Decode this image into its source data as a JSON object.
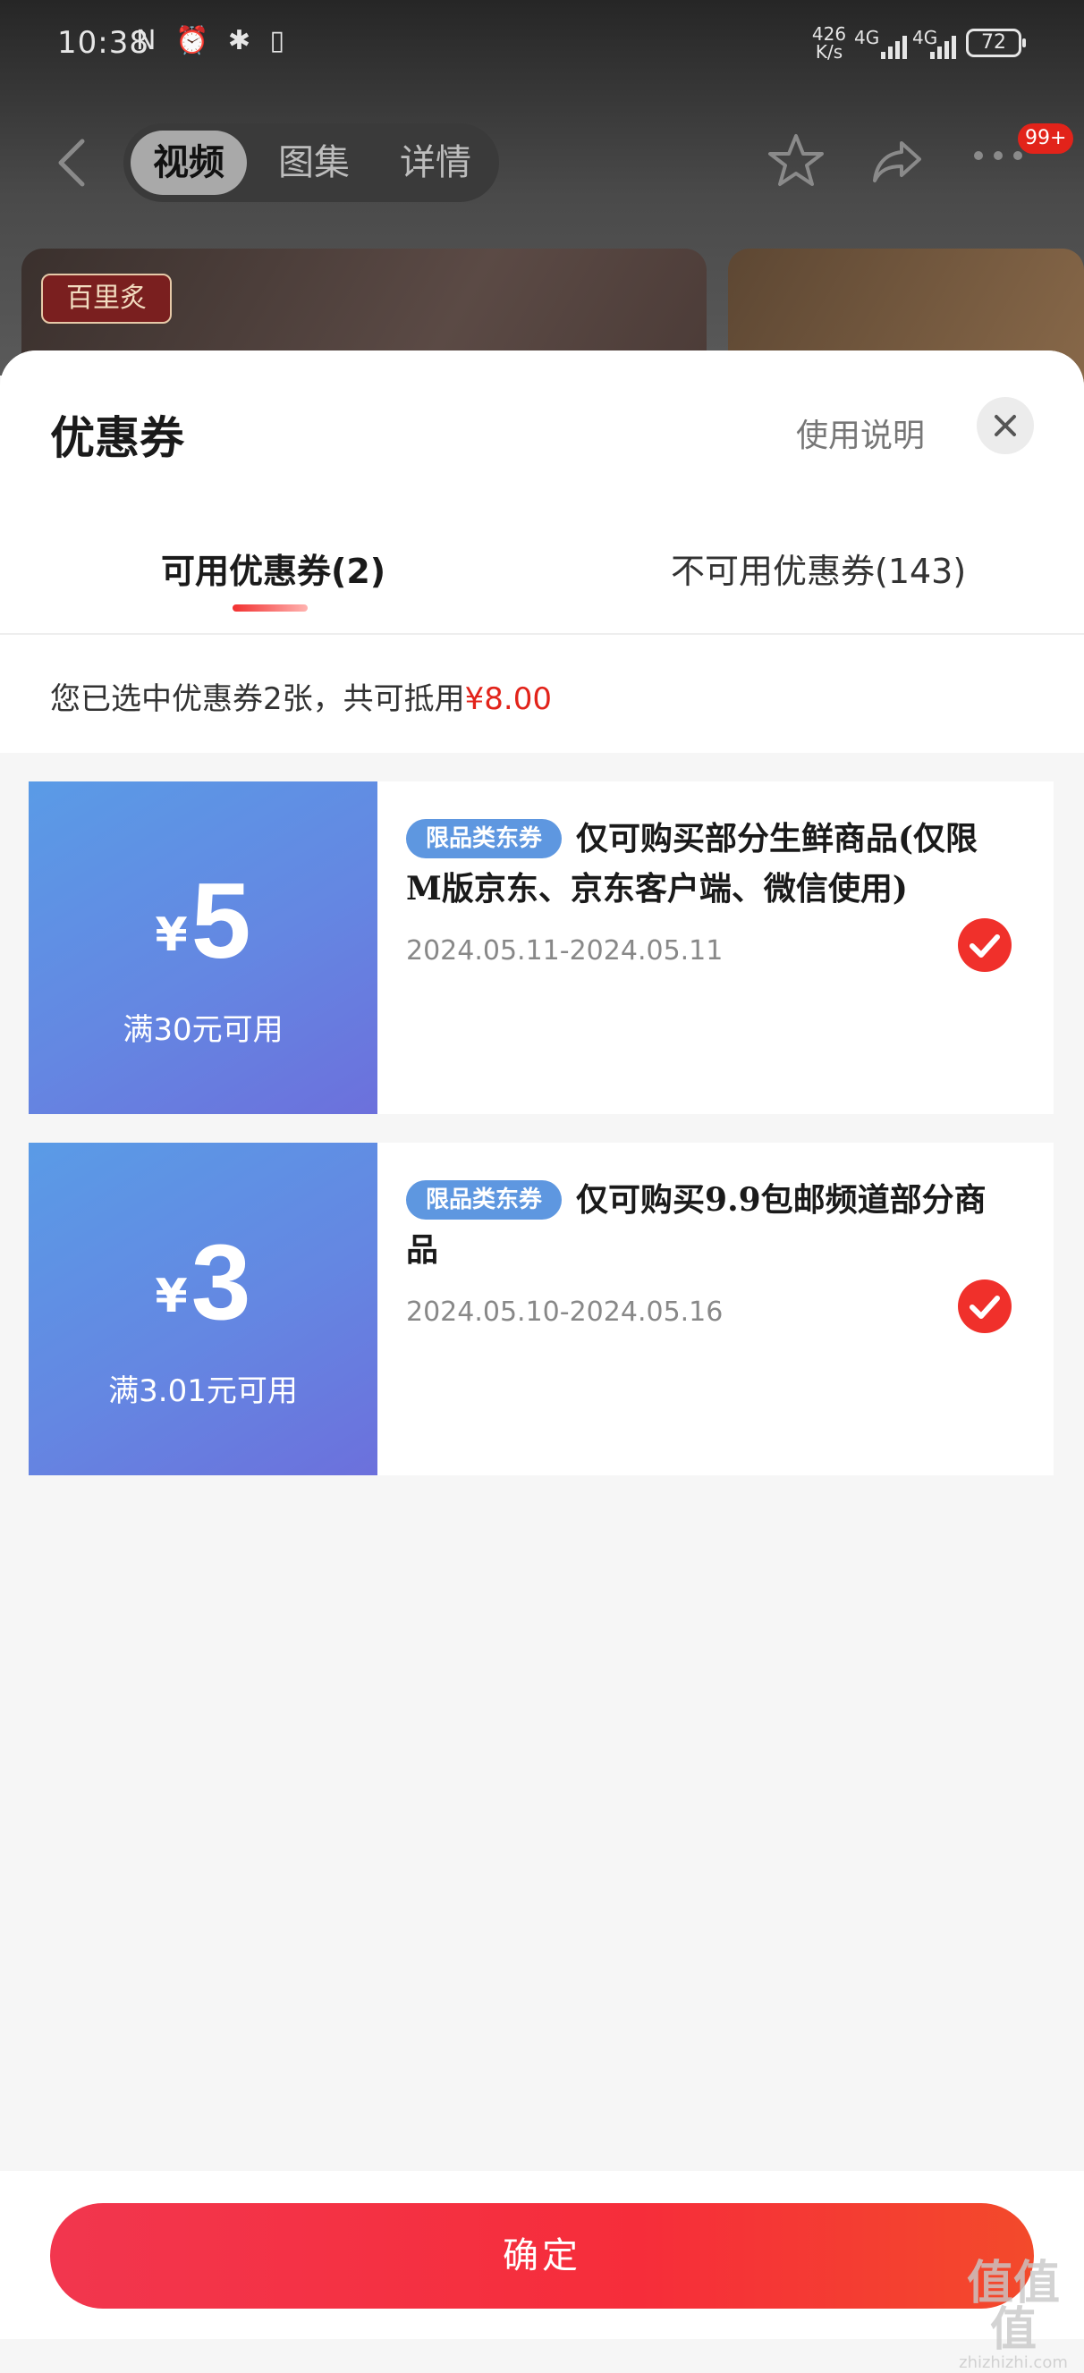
{
  "status_bar": {
    "time": "10:38",
    "indicator_icons": "N ⏰ ✱ ▯",
    "net_speed_value": "426",
    "net_speed_unit": "K/s",
    "network_1": "4G",
    "network_2": "4G",
    "battery": "72"
  },
  "nav": {
    "tabs": [
      "视频",
      "图集",
      "详情"
    ],
    "active_tab": "视频",
    "badge": "99+"
  },
  "background": {
    "thumbnail_tag": "百里炙"
  },
  "sheet": {
    "title": "优惠券",
    "help_link": "使用说明",
    "tabs": {
      "available": "可用优惠券(2)",
      "unavailable": "不可用优惠券(143)"
    },
    "summary_prefix": "您已选中优惠券2张，共可抵用",
    "summary_amount": "¥8.00",
    "coupons": [
      {
        "currency": "¥",
        "amount": "5",
        "condition": "满30元可用",
        "tag": "限品类东券",
        "description": "仅可购买部分生鲜商品(仅限M版京东、京东客户端、微信使用)",
        "validity": "2024.05.11-2024.05.11",
        "selected": true
      },
      {
        "currency": "¥",
        "amount": "3",
        "condition": "满3.01元可用",
        "tag": "限品类东券",
        "description": "仅可购买9.9包邮频道部分商品",
        "validity": "2024.05.10-2024.05.16",
        "selected": true
      }
    ],
    "confirm_label": "确定"
  },
  "watermark": {
    "mark": "值值值",
    "site": "zhizhizhi.com"
  },
  "colors": {
    "accent_red": "#e2231a",
    "coupon_blue": "#6487e2",
    "confirm_gradient_start": "#f2364e",
    "confirm_gradient_end": "#f34a2b"
  },
  "icons": [
    "back-arrow-icon",
    "star-icon",
    "share-icon",
    "more-icon",
    "close-icon",
    "check-icon"
  ]
}
